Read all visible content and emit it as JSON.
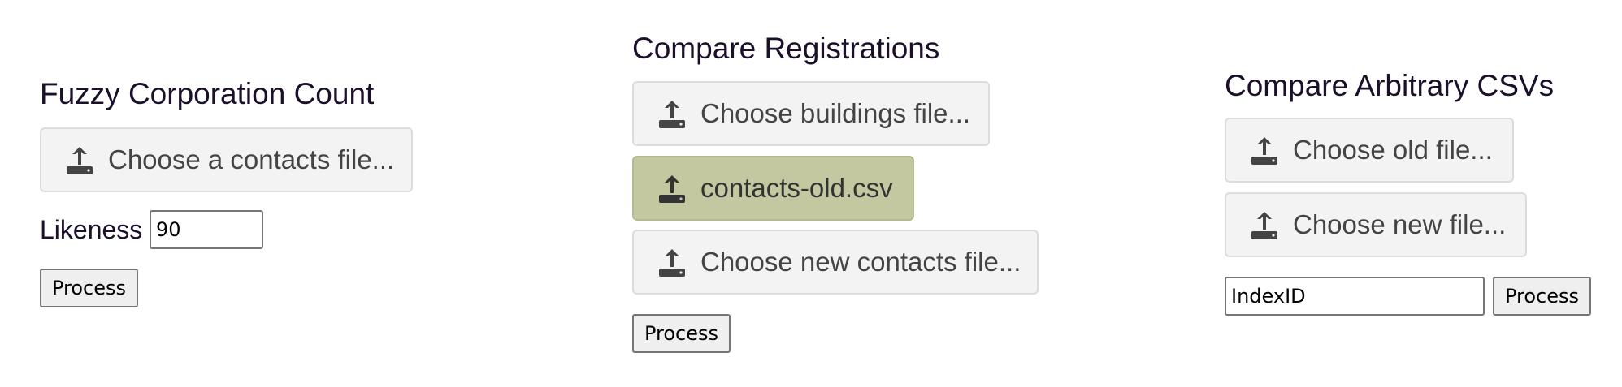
{
  "fuzzy": {
    "title": "Fuzzy Corporation Count",
    "contacts_button": "Choose a contacts file...",
    "likeness_label": "Likeness",
    "likeness_value": "90",
    "process_label": "Process"
  },
  "registrations": {
    "title": "Compare Registrations",
    "buildings_button": "Choose buildings file...",
    "old_contacts_button": "contacts-old.csv",
    "new_contacts_button": "Choose new contacts file...",
    "process_label": "Process"
  },
  "arbitrary": {
    "title": "Compare Arbitrary CSVs",
    "old_button": "Choose old file...",
    "new_button": "Choose new file...",
    "index_value": "IndexID",
    "process_label": "Process"
  },
  "colors": {
    "selected_file_bg": "#c3c8a1",
    "file_button_bg": "#f3f3f3",
    "title_text": "#1b0f2a"
  },
  "icons": {
    "file_button_icon": "upload-icon"
  }
}
